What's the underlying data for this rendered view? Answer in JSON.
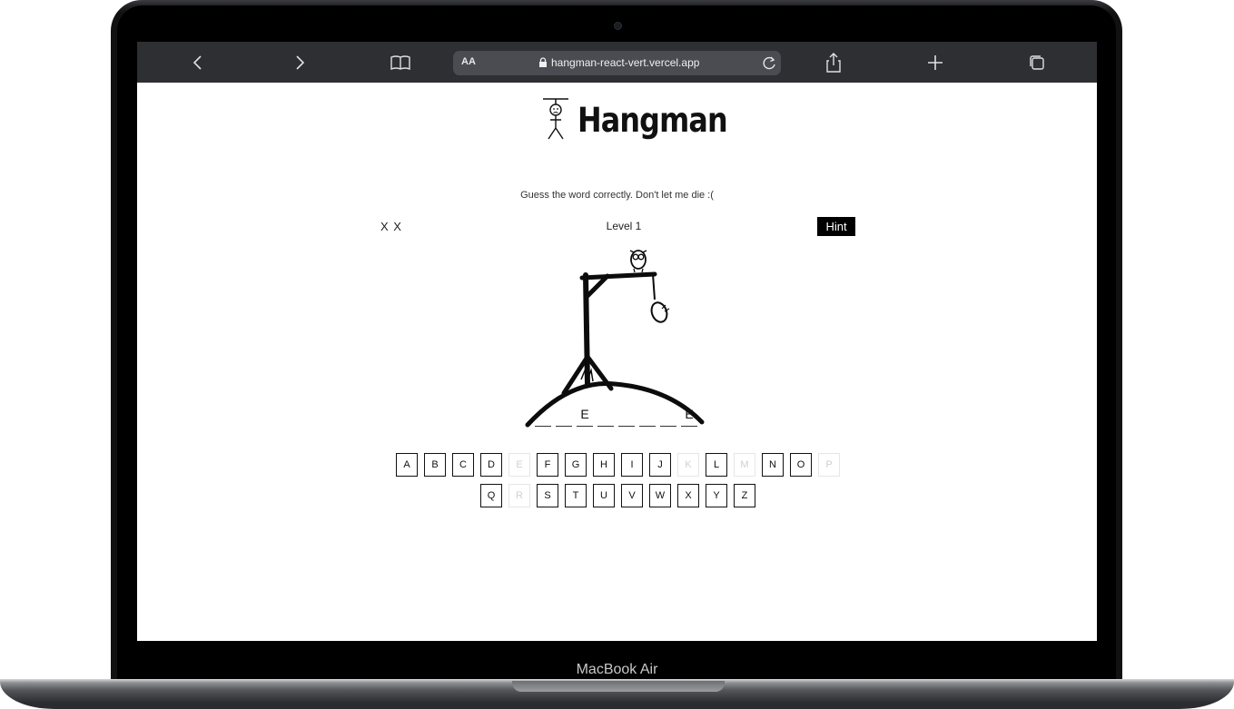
{
  "device": {
    "model_label": "MacBook Air"
  },
  "browser": {
    "url": "hangman-react-vert.vercel.app",
    "aa_label": "AA"
  },
  "game": {
    "title": "Hangman",
    "subtitle": "Guess the word correctly. Don't let me die :(",
    "lives": "X X",
    "level": "Level 1",
    "hint_label": "Hint",
    "word_slots": [
      "",
      "",
      "E",
      "",
      "",
      "",
      "",
      "E"
    ],
    "keyboard": {
      "row1": [
        {
          "letter": "A",
          "used": false
        },
        {
          "letter": "B",
          "used": false
        },
        {
          "letter": "C",
          "used": false
        },
        {
          "letter": "D",
          "used": false
        },
        {
          "letter": "E",
          "used": true
        },
        {
          "letter": "F",
          "used": false
        },
        {
          "letter": "G",
          "used": false
        },
        {
          "letter": "H",
          "used": false
        },
        {
          "letter": "I",
          "used": false
        },
        {
          "letter": "J",
          "used": false
        },
        {
          "letter": "K",
          "used": true
        },
        {
          "letter": "L",
          "used": false
        },
        {
          "letter": "M",
          "used": true
        },
        {
          "letter": "N",
          "used": false
        },
        {
          "letter": "O",
          "used": false
        },
        {
          "letter": "P",
          "used": true
        }
      ],
      "row2": [
        {
          "letter": "Q",
          "used": false
        },
        {
          "letter": "R",
          "used": true
        },
        {
          "letter": "S",
          "used": false
        },
        {
          "letter": "T",
          "used": false
        },
        {
          "letter": "U",
          "used": false
        },
        {
          "letter": "V",
          "used": false
        },
        {
          "letter": "W",
          "used": false
        },
        {
          "letter": "X",
          "used": false
        },
        {
          "letter": "Y",
          "used": false
        },
        {
          "letter": "Z",
          "used": false
        }
      ]
    }
  },
  "colors": {
    "toolbar": "#2d2f33",
    "urlbar": "#4a4c52",
    "ink": "#111111"
  }
}
